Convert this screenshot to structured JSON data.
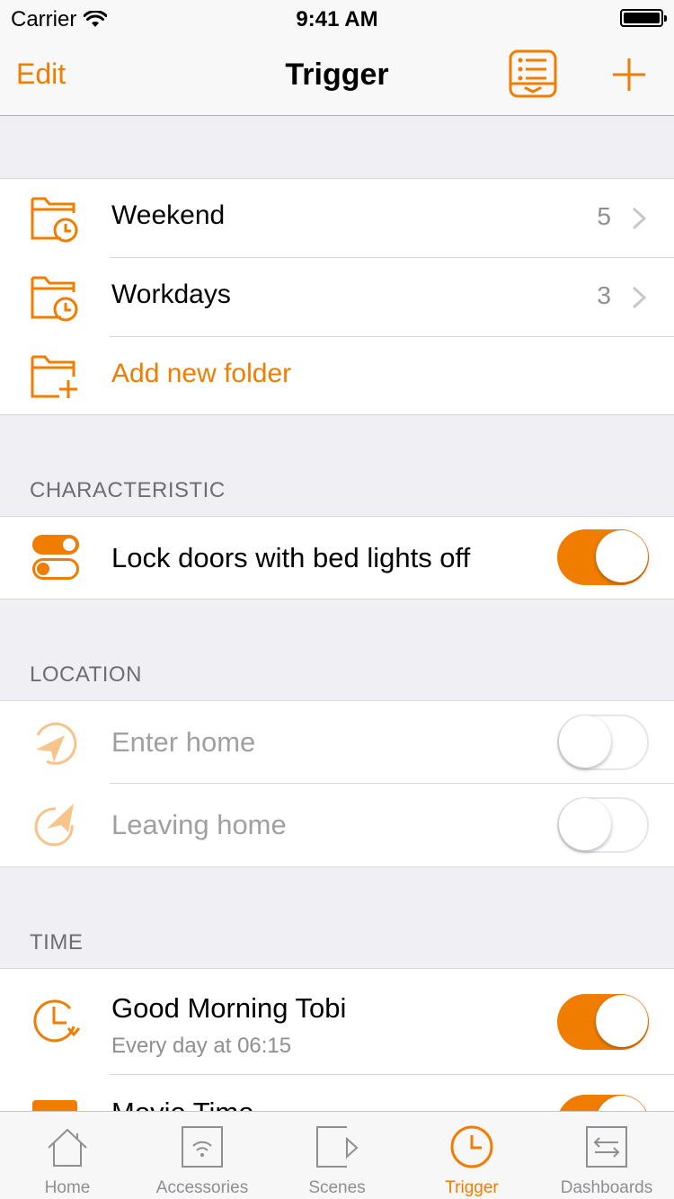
{
  "status": {
    "carrier": "Carrier",
    "time": "9:41 AM"
  },
  "nav": {
    "edit": "Edit",
    "title": "Trigger"
  },
  "folders": [
    {
      "label": "Weekend",
      "count": "5"
    },
    {
      "label": "Workdays",
      "count": "3"
    }
  ],
  "add_folder": "Add new folder",
  "characteristic": {
    "header": "CHARACTERISTIC",
    "items": [
      {
        "label": "Lock doors with bed lights off",
        "enabled": true
      }
    ]
  },
  "location": {
    "header": "LOCATION",
    "items": [
      {
        "label": "Enter home",
        "enabled": false
      },
      {
        "label": "Leaving home",
        "enabled": false
      }
    ]
  },
  "time": {
    "header": "TIME",
    "items": [
      {
        "label": "Good Morning Tobi",
        "subtitle": "Every day at 06:15",
        "enabled": true
      },
      {
        "label": "Movie Time",
        "enabled": true
      }
    ]
  },
  "tabs": [
    {
      "label": "Home"
    },
    {
      "label": "Accessories"
    },
    {
      "label": "Scenes"
    },
    {
      "label": "Trigger",
      "active": true
    },
    {
      "label": "Dashboards"
    }
  ],
  "colors": {
    "accent": "#f07d00",
    "accent_light": "#f7c489",
    "toggle_off_border": "#e5e5ea"
  }
}
